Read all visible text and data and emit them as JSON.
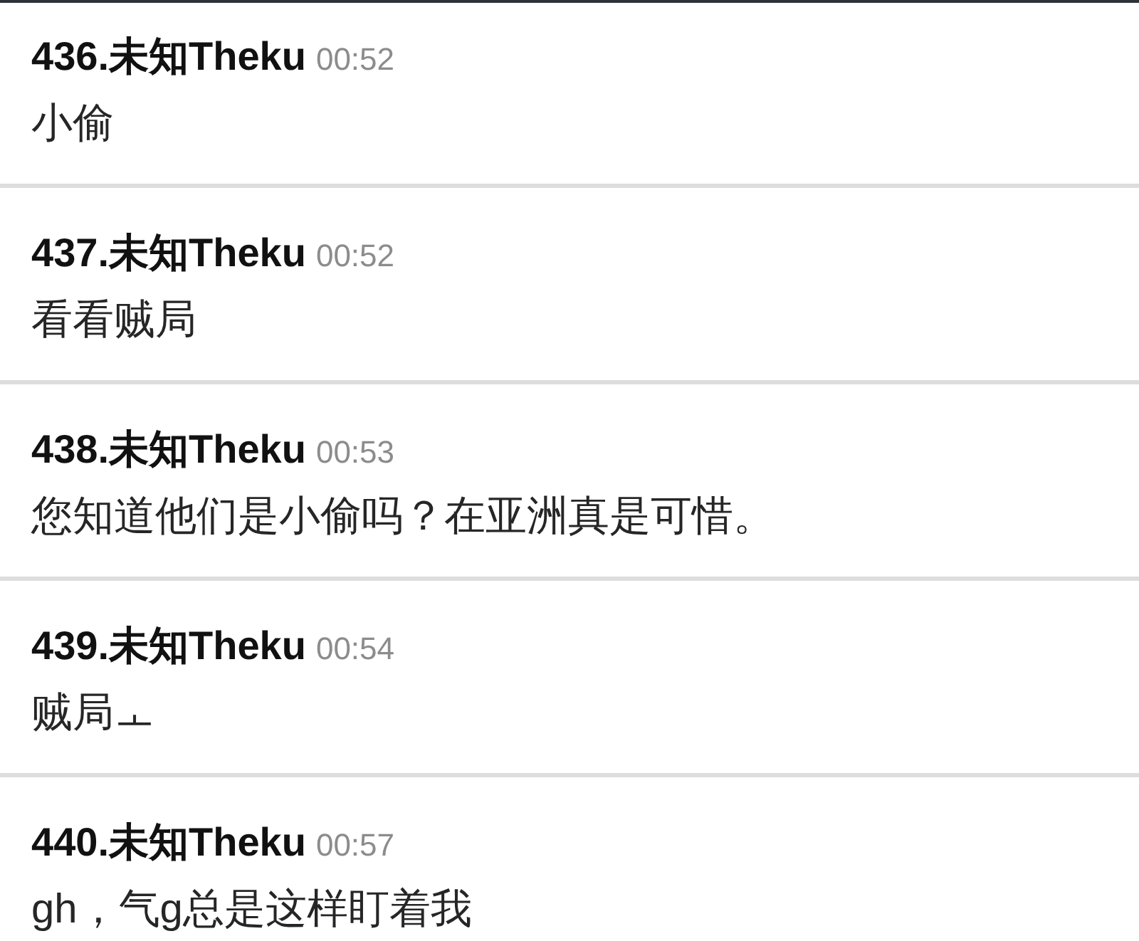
{
  "messages": [
    {
      "author": "436.未知Theku",
      "time": "00:52",
      "text": "小偷"
    },
    {
      "author": "437.未知Theku",
      "time": "00:52",
      "text": "看看贼局"
    },
    {
      "author": "438.未知Theku",
      "time": "00:53",
      "text": "您知道他们是小偷吗？在亚洲真是可惜。"
    },
    {
      "author": "439.未知Theku",
      "time": "00:54",
      "text": "贼局ㅗ"
    },
    {
      "author": "440.未知Theku",
      "time": "00:57",
      "text": "gh，气g总是这样盯着我"
    }
  ]
}
